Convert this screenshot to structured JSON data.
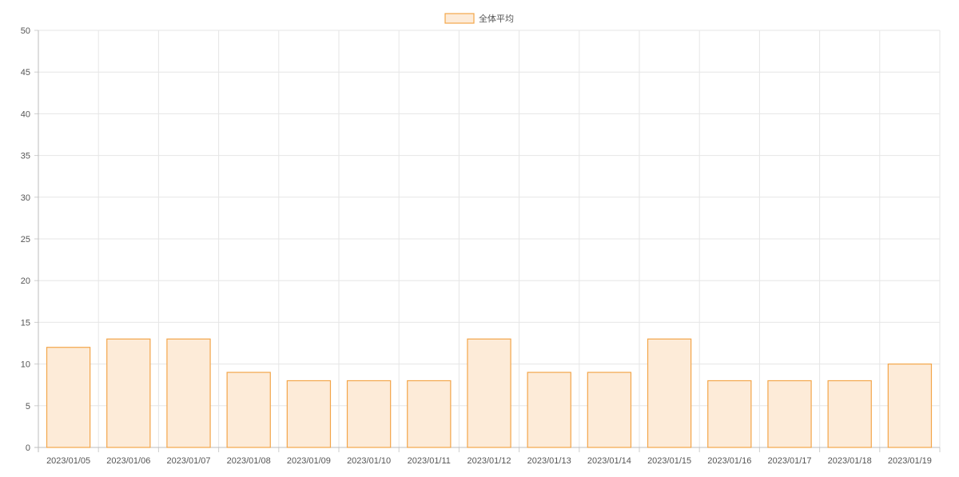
{
  "chart_data": {
    "type": "bar",
    "title": "",
    "xlabel": "",
    "ylabel": "",
    "legend_position": "top-center",
    "grid": true,
    "ylim": [
      0,
      50
    ],
    "yticks": [
      0,
      5,
      10,
      15,
      20,
      25,
      30,
      35,
      40,
      45,
      50
    ],
    "categories": [
      "2023/01/05",
      "2023/01/06",
      "2023/01/07",
      "2023/01/08",
      "2023/01/09",
      "2023/01/10",
      "2023/01/11",
      "2023/01/12",
      "2023/01/13",
      "2023/01/14",
      "2023/01/15",
      "2023/01/16",
      "2023/01/17",
      "2023/01/18",
      "2023/01/19"
    ],
    "series": [
      {
        "name": "全体平均",
        "values": [
          12,
          13,
          13,
          9,
          8,
          8,
          8,
          13,
          9,
          9,
          13,
          8,
          8,
          8,
          10
        ],
        "fill_color": "#fdebd8",
        "stroke_color": "#f3a64a"
      }
    ]
  }
}
